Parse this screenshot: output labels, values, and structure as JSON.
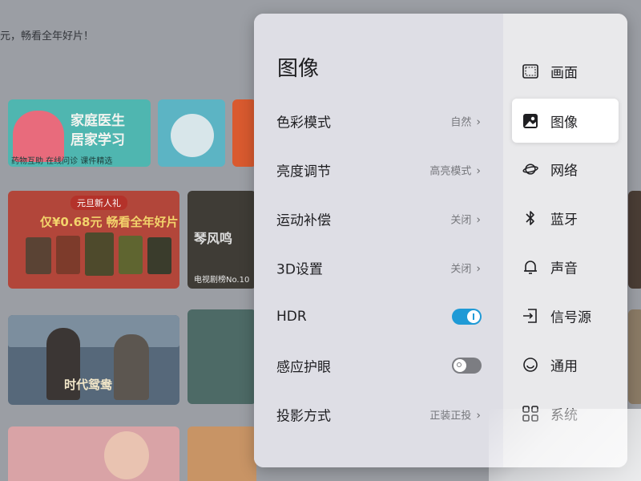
{
  "background": {
    "promo_text": "元，畅看全年好片！",
    "tile_health_line1": "家庭医生",
    "tile_health_line2": "居家学习",
    "tile_health_sub": "药物互助 在线问诊 课件精选",
    "tile_newyear_badge": "元旦新人礼",
    "tile_newyear_offer": "仅¥0.68元 畅看全年好片",
    "tile_drama_title": "琴风鸣",
    "tile_drama_caption": "电视剧榜No.10",
    "tile_movie_title": "时代鸳鸯"
  },
  "panel": {
    "title": "图像",
    "rows": [
      {
        "label": "色彩模式",
        "value": "自然",
        "type": "select"
      },
      {
        "label": "亮度调节",
        "value": "高亮模式",
        "type": "select"
      },
      {
        "label": "运动补偿",
        "value": "关闭",
        "type": "select"
      },
      {
        "label": "3D设置",
        "value": "关闭",
        "type": "select"
      },
      {
        "label": "HDR",
        "state": "on",
        "type": "toggle"
      },
      {
        "label": "感应护眼",
        "state": "off",
        "type": "toggle"
      },
      {
        "label": "投影方式",
        "value": "正装正投",
        "type": "select"
      }
    ],
    "nav": [
      {
        "label": "画面",
        "icon": "screen-icon"
      },
      {
        "label": "图像",
        "icon": "image-icon",
        "active": true
      },
      {
        "label": "网络",
        "icon": "planet-icon"
      },
      {
        "label": "蓝牙",
        "icon": "bluetooth-icon"
      },
      {
        "label": "声音",
        "icon": "bell-icon"
      },
      {
        "label": "信号源",
        "icon": "input-source-icon"
      },
      {
        "label": "通用",
        "icon": "general-icon"
      },
      {
        "label": "系统",
        "icon": "grid-icon"
      }
    ]
  },
  "colors": {
    "accent": "#1f9ad6",
    "panel_left": "#dedee5",
    "panel_right": "#e9e9eb",
    "active_nav_bg": "#ffffff"
  }
}
